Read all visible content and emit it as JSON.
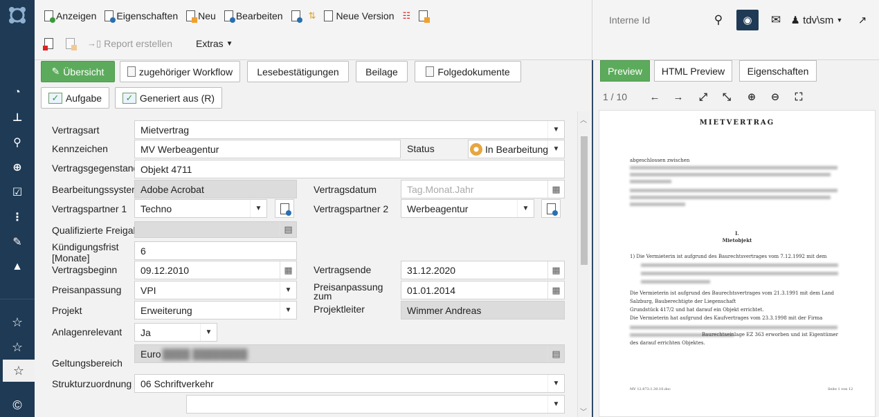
{
  "toolbar": {
    "row1": [
      {
        "label": "Anzeigen",
        "icon": "view-doc-icon"
      },
      {
        "label": "Eigenschaften",
        "icon": "properties-doc-icon"
      },
      {
        "label": "Neu",
        "icon": "new-doc-icon"
      },
      {
        "label": "Bearbeiten",
        "icon": "edit-doc-icon"
      },
      {
        "label": "",
        "icon": "upload-doc-icon"
      },
      {
        "label": "",
        "icon": "sort-icon"
      },
      {
        "label": "Neue Version",
        "icon": "new-version-icon"
      },
      {
        "label": "",
        "icon": "delete-list-icon"
      },
      {
        "label": "",
        "icon": "lock-doc-icon"
      }
    ],
    "row2": [
      {
        "label": "",
        "icon": "delete-doc-icon"
      },
      {
        "label": "",
        "icon": "mail-doc-icon"
      },
      {
        "label": "Report erstellen",
        "icon": "report-icon"
      },
      {
        "label": "Extras",
        "icon": "extras-caret-icon"
      }
    ]
  },
  "topright": {
    "search_placeholder": "Interne Id",
    "user": "tdv\\sm"
  },
  "tabs": {
    "row1": [
      "Übersicht",
      "zugehöriger Workflow",
      "Lesebestätigungen",
      "Beilage",
      "Folgedokumente"
    ],
    "row2": [
      "Aufgabe",
      "Generiert aus (R)"
    ]
  },
  "form": {
    "vertragsart": {
      "label": "Vertragsart",
      "value": "Mietvertrag"
    },
    "kennzeichen": {
      "label": "Kennzeichen",
      "value": "MV Werbeagentur"
    },
    "status": {
      "label": "Status",
      "value": "In Bearbeitung"
    },
    "vertragsgegenstand": {
      "label": "Vertragsgegenstand",
      "value": "Objekt 4711"
    },
    "bearbeitungssystem": {
      "label": "Bearbeitungssystem",
      "value": "Adobe Acrobat"
    },
    "vertragsdatum": {
      "label": "Vertragsdatum",
      "placeholder": "Tag.Monat.Jahr"
    },
    "vertragspartner1": {
      "label": "Vertragspartner 1",
      "value": "Techno"
    },
    "vertragspartner2": {
      "label": "Vertragspartner 2",
      "value": "Werbeagentur"
    },
    "qualifizierte_freigabe": {
      "label": "Qualifizierte Freigabe",
      "value": ""
    },
    "kuendigungsfrist": {
      "label": "Kündigungsfrist [Monate]",
      "value": "6"
    },
    "vertragsbeginn": {
      "label": "Vertragsbeginn",
      "value": "09.12.2010"
    },
    "vertragsende": {
      "label": "Vertragsende",
      "value": "31.12.2020"
    },
    "preisanpassung": {
      "label": "Preisanpassung",
      "value": "VPI"
    },
    "preisanpassung_zum": {
      "label": "Preisanpassung zum",
      "value": "01.01.2014"
    },
    "projekt": {
      "label": "Projekt",
      "value": "Erweiterung"
    },
    "projektleiter": {
      "label": "Projektleiter",
      "value": "Wimmer Andreas"
    },
    "anlagenrelevant": {
      "label": "Anlagenrelevant",
      "value": "Ja"
    },
    "geltungsbereich": {
      "label": "Geltungsbereich",
      "value": "Euro"
    },
    "strukturzuordnung": {
      "label": "Strukturzuordnung",
      "value": "06 Schriftverkehr"
    }
  },
  "preview": {
    "tabs": [
      "Preview",
      "HTML Preview",
      "Eigenschaften"
    ],
    "page_counter": "1 / 10",
    "doc": {
      "title": "MIETVERTRAG",
      "intro": "abgeschlossen zwischen",
      "section_num": "I.",
      "section_title": "Mietobjekt",
      "para1": "1)    Die Vermieterin ist aufgrund des Baurechtsvertrages vom 7.12.1992  mit dem",
      "line_a": "Die Vermieterin ist aufgrund des Baurechtsvertrages vom 21.3.1991  mit dem Land",
      "line_b": "Salzburg, Bauberechtigte der Liegenschaft",
      "line_c": "Grundstück 417/2 und hat darauf ein Objekt errichtet.",
      "line_d": "Die Vermieterin hat aufgrund des Kaufvertrages vom 23.3.1998 mit der Firma",
      "line_e": "Baurechtseinlage EZ 363 erworben und ist Eigentümer",
      "line_f": "des darauf errichten Objektes.",
      "footer_left": "MV 12.873.1.30.10.doc",
      "footer_right": "Seite 1 von 12"
    }
  }
}
